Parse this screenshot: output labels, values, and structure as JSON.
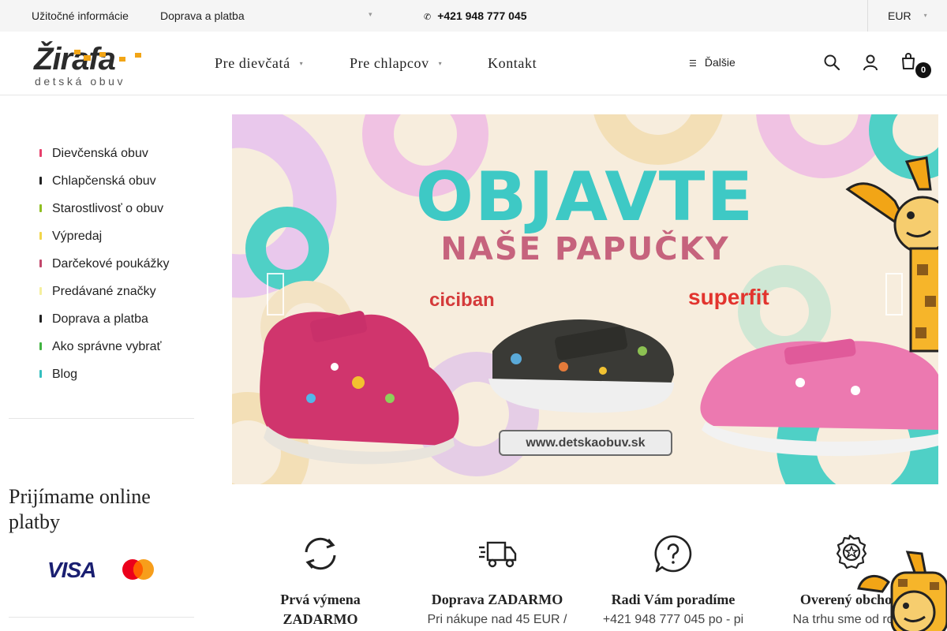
{
  "topbar": {
    "links": [
      "Užitočné informácie",
      "Doprava a platba"
    ],
    "phone": "+421 948 777 045",
    "currency": "EUR"
  },
  "header": {
    "logo": {
      "name": "Žirafa",
      "tagline": "detská obuv"
    },
    "nav": [
      "Pre dievčatá",
      "Pre chlapcov",
      "Kontakt"
    ],
    "more_label": "Ďalšie",
    "cart_count": "0",
    "icons": [
      "search-icon",
      "user-icon",
      "cart-icon"
    ]
  },
  "sidebar": {
    "menu": [
      {
        "label": "Dievčenská obuv",
        "color": "#e73f6b"
      },
      {
        "label": "Chlapčenská obuv",
        "color": "#222222"
      },
      {
        "label": "Starostlivosť o obuv",
        "color": "#8fbf21"
      },
      {
        "label": "Výpredaj",
        "color": "#f2d64b"
      },
      {
        "label": "Darčekové poukážky",
        "color": "#c2476b"
      },
      {
        "label": "Predávané značky",
        "color": "#f5ef9e"
      },
      {
        "label": "Doprava a platba",
        "color": "#222222"
      },
      {
        "label": "Ako správne vybrať",
        "color": "#41b341"
      },
      {
        "label": "Blog",
        "color": "#35bfbf"
      }
    ],
    "payments_title": "Prijímame online platby",
    "payment_brands": [
      "VISA",
      "mastercard"
    ]
  },
  "banner": {
    "title": "OBJAVTE",
    "subtitle": "NAŠE PAPUČKY",
    "brands": [
      "ciciban",
      "superfit"
    ],
    "url": "www.detskaobuv.sk",
    "colors": {
      "title": "#3ec9c5",
      "subtitle": "#c6637d",
      "background": "#f7eddd"
    }
  },
  "features": [
    {
      "icon": "refresh-icon",
      "title": "Prvá výmena ZADARMO",
      "desc": ""
    },
    {
      "icon": "truck-icon",
      "title": "Doprava ZADARMO",
      "desc": "Pri nákupe nad 45 EUR /"
    },
    {
      "icon": "question-bubble-icon",
      "title": "Radi Vám poradíme",
      "desc": "+421 948 777 045 po - pi"
    },
    {
      "icon": "award-badge-icon",
      "title": "Overený obchod",
      "desc": "Na trhu sme od roku"
    }
  ]
}
